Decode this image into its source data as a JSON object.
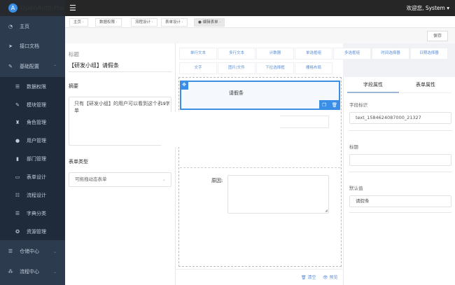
{
  "header": {
    "app_name": "OpenAuth.Pro",
    "welcome": "欢迎您, System"
  },
  "sidebar": {
    "items": [
      {
        "label": "主页",
        "icon": "dashboard-icon"
      },
      {
        "label": "接口文档",
        "icon": "send-icon"
      },
      {
        "label": "基础配置",
        "icon": "edit-icon",
        "expanded": true
      },
      {
        "label": "数据权限",
        "icon": "list-icon"
      },
      {
        "label": "模块管理",
        "icon": "edit-icon"
      },
      {
        "label": "角色管理",
        "icon": "role-icon"
      },
      {
        "label": "用户管理",
        "icon": "user-icon"
      },
      {
        "label": "部门管理",
        "icon": "chart-icon"
      },
      {
        "label": "表单设计",
        "icon": "form-icon"
      },
      {
        "label": "流程设计",
        "icon": "flow-icon"
      },
      {
        "label": "字典分类",
        "icon": "list-icon"
      },
      {
        "label": "资源管理",
        "icon": "resource-icon"
      },
      {
        "label": "仓储中心",
        "icon": "list-icon"
      },
      {
        "label": "流程中心",
        "icon": "sitemap-icon"
      }
    ]
  },
  "tags": [
    "主页",
    "数据权限",
    "流程设计",
    "表单设计",
    "编辑表单"
  ],
  "toolbar": {
    "save": "保存"
  },
  "left": {
    "title_label": "标题",
    "title_value": "【研发小组】请假条",
    "summary_label": "摘要",
    "summary_value": "只有【研发小组】的用户可以看到这个表单",
    "summary_count": "19字",
    "type_label": "表单类型",
    "type_value": "可拖拽动态表单"
  },
  "widgets": [
    "单行文本",
    "多行文本",
    "计数器",
    "单选框组",
    "多选框组",
    "时间选择器",
    "日期选择器",
    "文字",
    "图片/文件",
    "下拉选择框",
    "栅格布局"
  ],
  "canvas": {
    "selected_text": "请假条",
    "reason_label": "原因:",
    "clear": "清空",
    "preview": "预览"
  },
  "right": {
    "tabs": [
      "字段属性",
      "表单属性"
    ],
    "field_id_label": "字段标识",
    "field_id": "text_1584624087000_21327",
    "title_label": "标题",
    "title_value": "",
    "default_label": "默认值",
    "default_value": "请假条"
  },
  "colors": {
    "accent": "#3a8ee6",
    "sidebar": "#2d3b4e",
    "submenu": "#1f2b3a",
    "header": "#262626"
  }
}
